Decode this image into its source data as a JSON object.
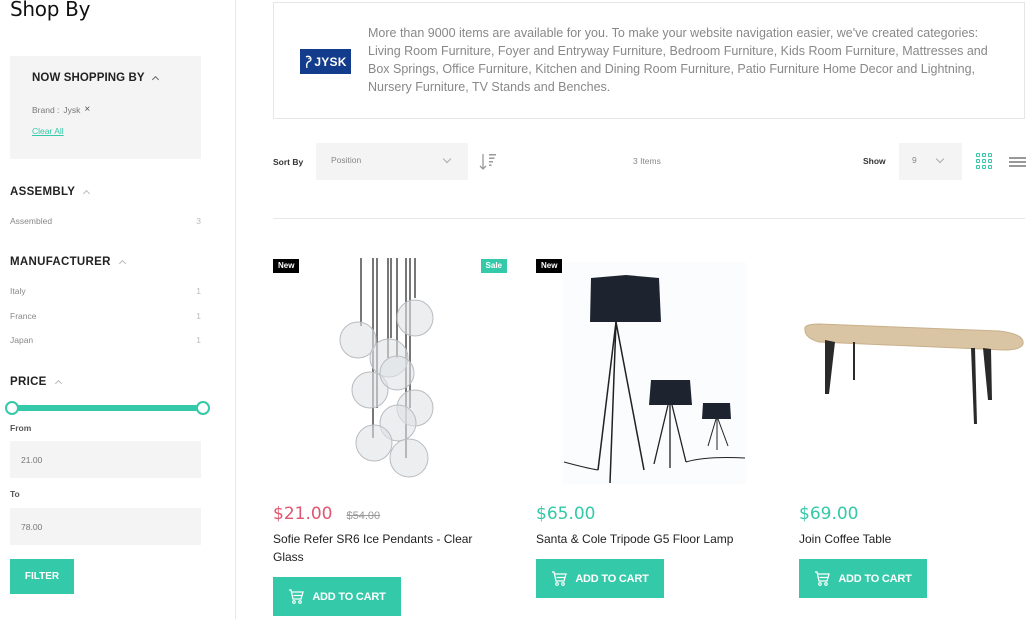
{
  "sidebar": {
    "title": "Shop By",
    "now_shopping": {
      "title": "NOW SHOPPING BY",
      "filter_label": "Brand :",
      "filter_value": "Jysk",
      "remove_icon": "×",
      "clear_all": "Clear All"
    },
    "filters": [
      {
        "title": "ASSEMBLY",
        "options": [
          {
            "label": "Assembled",
            "count": "3"
          }
        ]
      },
      {
        "title": "MANUFACTURER",
        "options": [
          {
            "label": "Italy",
            "count": "1"
          },
          {
            "label": "France",
            "count": "1"
          },
          {
            "label": "Japan",
            "count": "1"
          }
        ]
      }
    ],
    "price": {
      "title": "PRICE",
      "slider_min_fraction": 0,
      "slider_max_fraction": 1,
      "from_label": "From",
      "from_value": "21.00",
      "to_label": "To",
      "to_value": "78.00",
      "filter_button": "FILTER"
    }
  },
  "banner": {
    "logo_text": "JYSK",
    "description": "More than 9000 items are available for you. To make your website navigation easier, we've created categories: Living Room Furniture, Foyer and Entryway Furniture, Bedroom Furniture, Kids Room Furniture, Mattresses and Box Springs, Office Furniture, Kitchen and Dining Room Furniture, Patio Furniture Home Decor and Lightning, Nursery Furniture, TV Stands and Benches."
  },
  "toolbar": {
    "sort_label": "Sort By",
    "sort_value": "Position",
    "items_count": "3 Items",
    "show_label": "Show",
    "show_value": "9"
  },
  "colors": {
    "accent": "#34c9a8",
    "sale_price": "#e0566f",
    "badge_new": "#000000",
    "jysk_blue": "#143c8c"
  },
  "products": [
    {
      "name": "Sofie Refer SR6 Ice Pendants - Clear Glass",
      "price": "$21.00",
      "old_price": "$54.00",
      "badges": [
        "New",
        "Sale"
      ],
      "cart_label": "ADD TO CART"
    },
    {
      "name": "Santa & Cole Tripode G5 Floor Lamp",
      "price": "$65.00",
      "badges": [
        "New"
      ],
      "cart_label": "ADD TO CART"
    },
    {
      "name": "Join Coffee Table",
      "price": "$69.00",
      "badges": [],
      "cart_label": "ADD TO CART"
    }
  ]
}
